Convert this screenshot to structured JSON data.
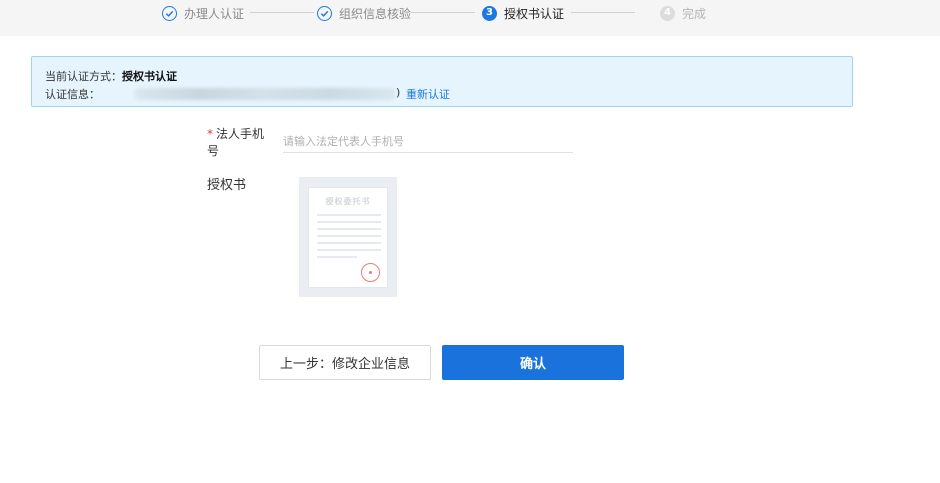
{
  "stepper": {
    "steps": [
      {
        "label": "办理人认证",
        "status": "done",
        "marker": "✓"
      },
      {
        "label": "组织信息核验",
        "status": "done",
        "marker": "✓"
      },
      {
        "label": "授权书认证",
        "status": "active",
        "marker": "3"
      },
      {
        "label": "完成",
        "status": "pending",
        "marker": "4"
      }
    ]
  },
  "auth_info": {
    "method_label": "当前认证方式：",
    "method_value": "授权书认证",
    "info_label": "认证信息：",
    "info_paren": ")",
    "reauth_link": "重新认证"
  },
  "form": {
    "phone": {
      "required_mark": "*",
      "label": "法人手机号",
      "value": "",
      "placeholder": "请输入法定代表人手机号"
    },
    "authorization": {
      "label": "授权书",
      "thumb_title": "授权委托书"
    }
  },
  "actions": {
    "prev_label": "上一步：修改企业信息",
    "confirm_label": "确认"
  },
  "colors": {
    "primary": "#1a72dc",
    "info_bg": "#e6f4fd",
    "info_border": "#9fd3f3",
    "required": "#e23c3c"
  }
}
